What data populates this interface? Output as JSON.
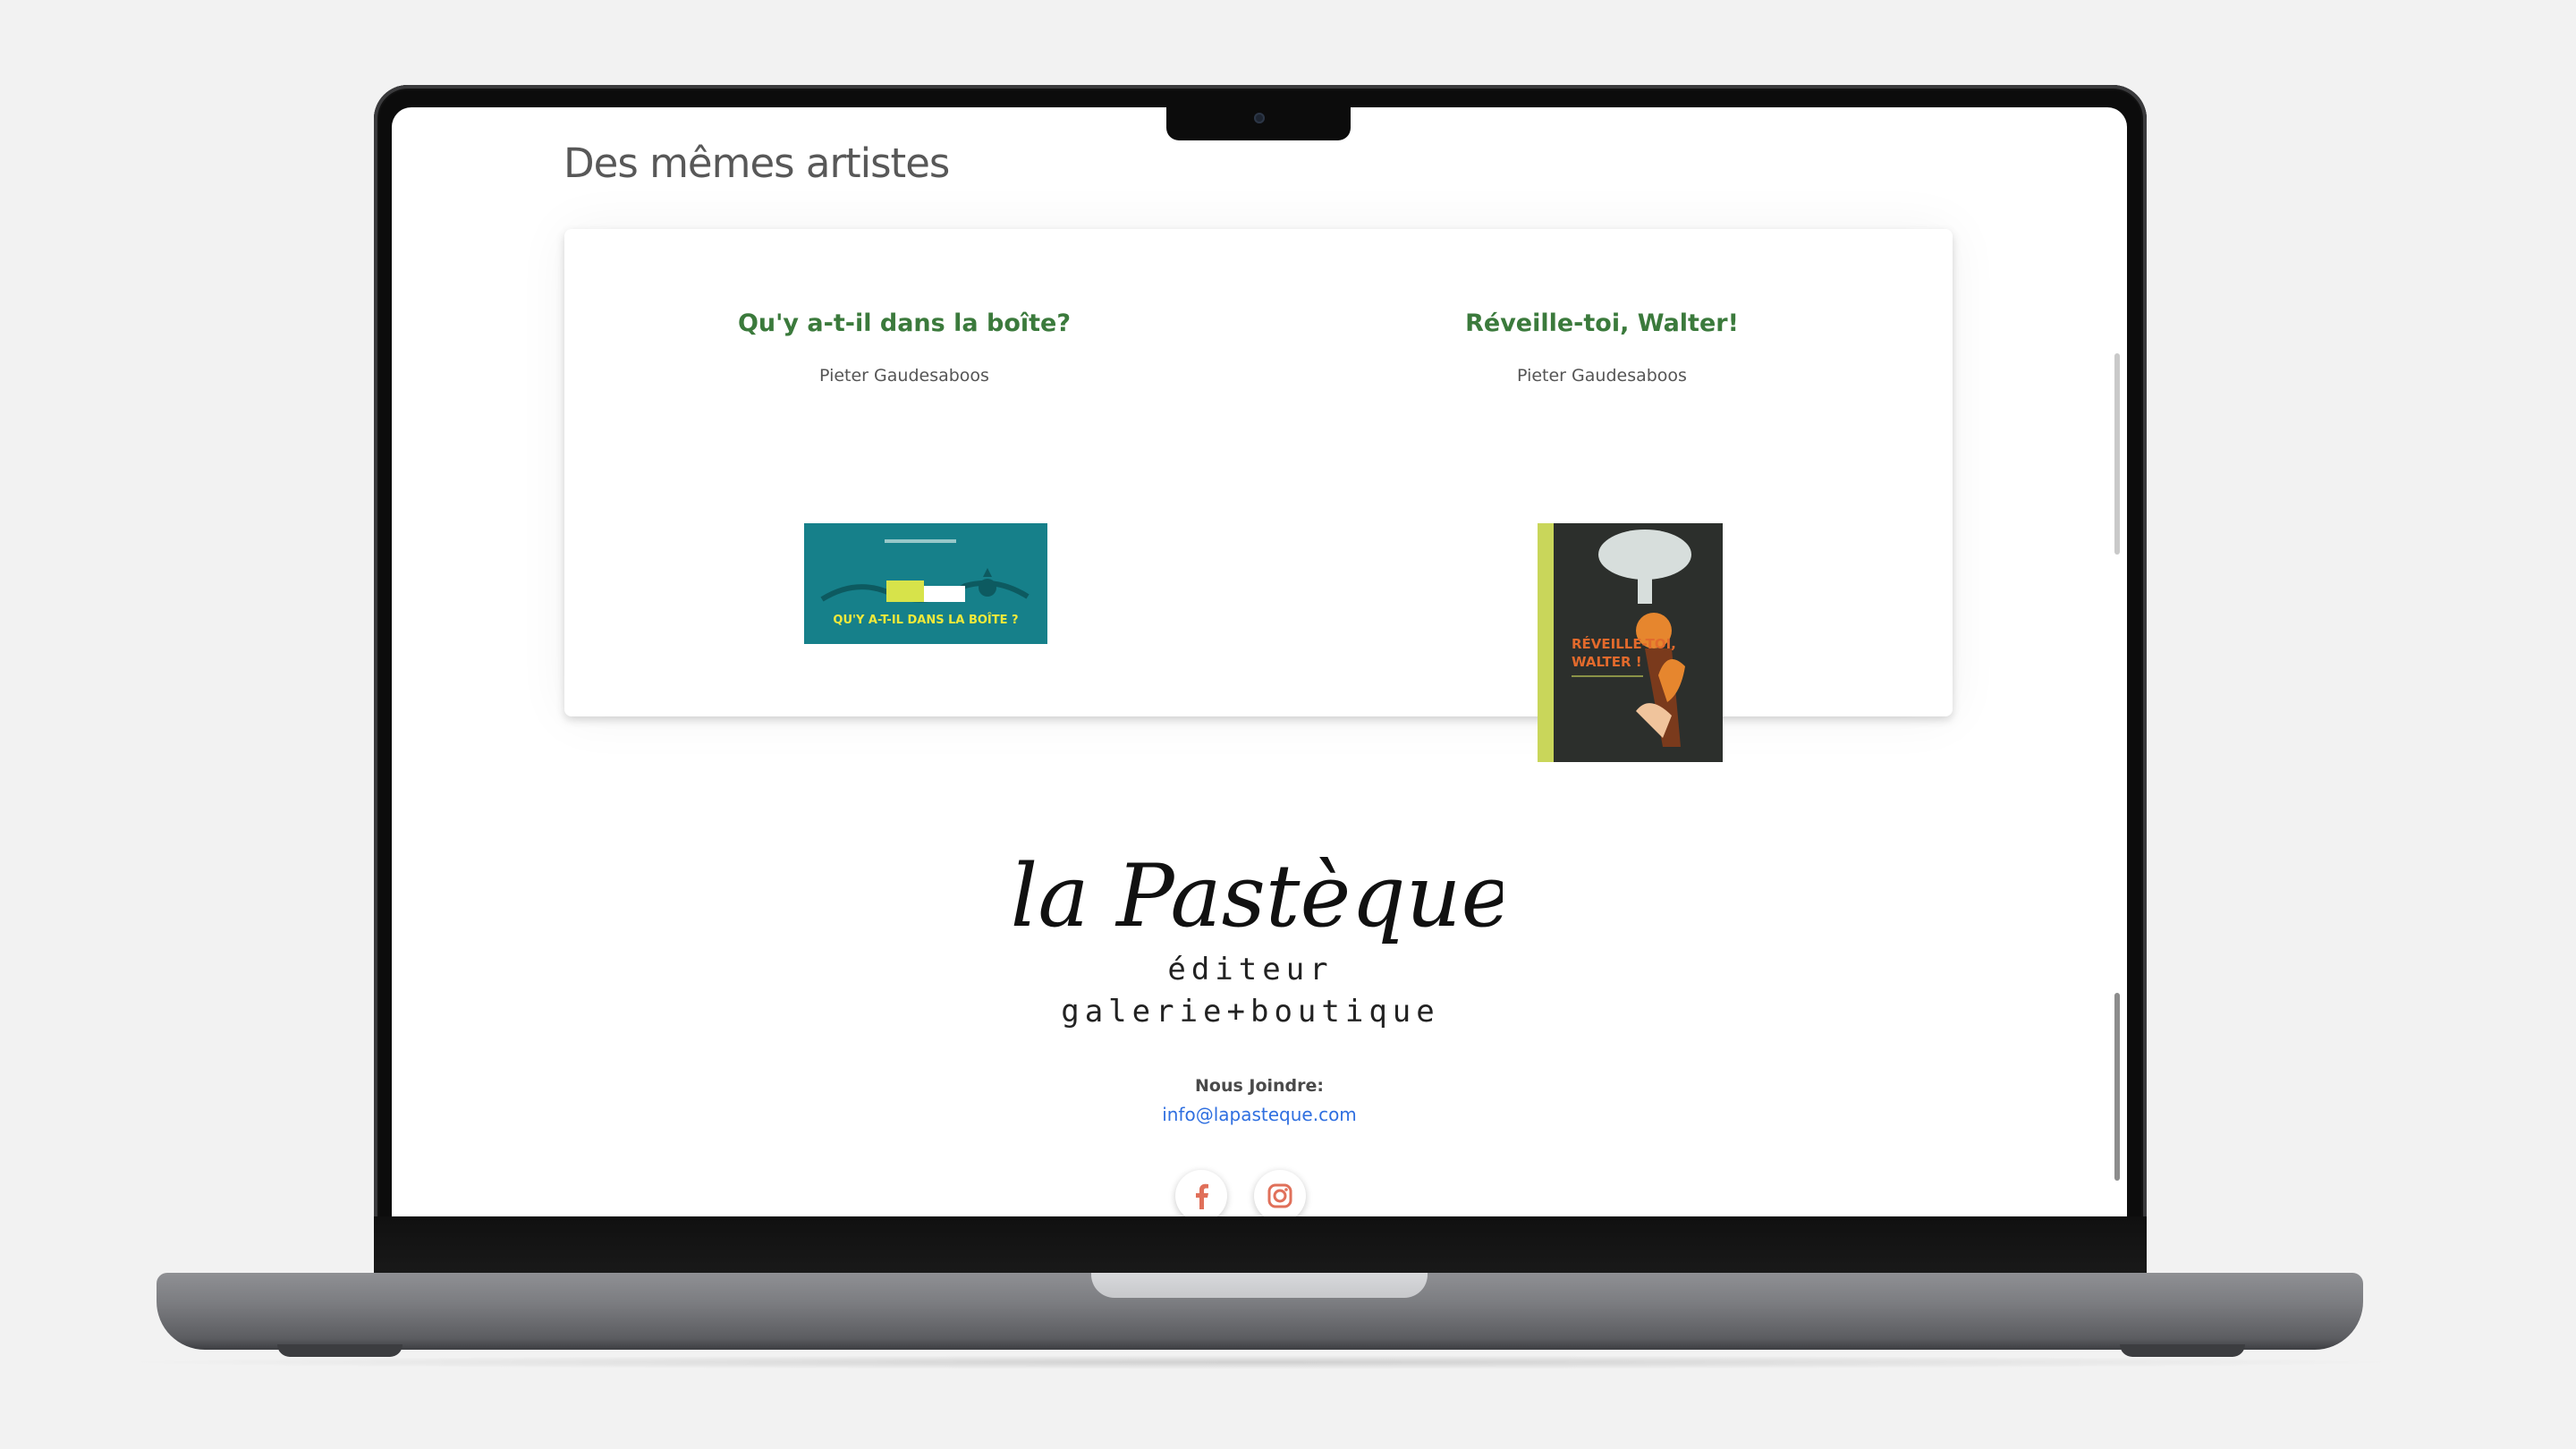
{
  "section": {
    "title": "Des mêmes artistes"
  },
  "books": [
    {
      "title": "Qu'y a-t-il dans la boîte?",
      "author": "Pieter Gaudesaboos",
      "cover_text": "QU'Y A-T-IL DANS LA BOÎTE ?",
      "cover_color": "#16808a"
    },
    {
      "title": "Réveille-toi, Walter!",
      "author": "Pieter Gaudesaboos",
      "cover_text_1": "RÉVEILLE-TOI,",
      "cover_text_2": "WALTER !",
      "cover_color": "#2c2f2c"
    }
  ],
  "footer": {
    "logo": {
      "script": "la Pastèque",
      "line1": "éditeur",
      "line2": "galerie+boutique"
    },
    "contact_label": "Nous Joindre:",
    "contact_email": "info@lapasteque.com",
    "social": [
      {
        "name": "facebook",
        "icon": "facebook-icon"
      },
      {
        "name": "instagram",
        "icon": "instagram-icon"
      }
    ]
  },
  "colors": {
    "book_title": "#3b7a3c",
    "link": "#2f6fe0",
    "social_icon": "#e0705a"
  }
}
